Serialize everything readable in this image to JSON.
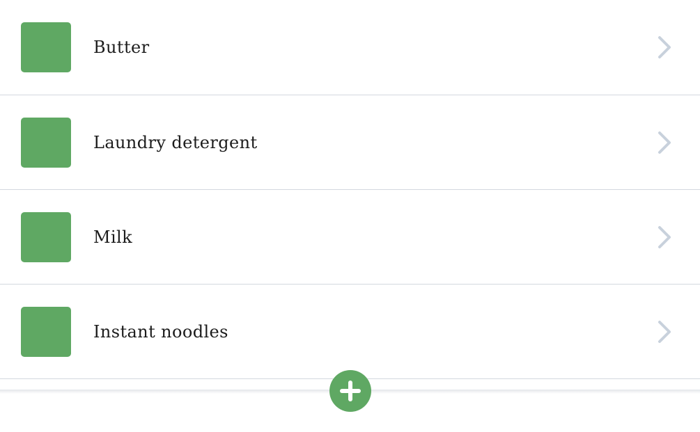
{
  "items": [
    {
      "label": "Butter"
    },
    {
      "label": "Laundry detergent"
    },
    {
      "label": "Milk"
    },
    {
      "label": "Instant noodles"
    }
  ],
  "icons": {
    "row_chevron": "chevron-right-icon",
    "add": "plus-icon"
  },
  "colors": {
    "accent": "#5fa863",
    "chevron": "#c8d1dc",
    "divider": "#d3d8df"
  }
}
